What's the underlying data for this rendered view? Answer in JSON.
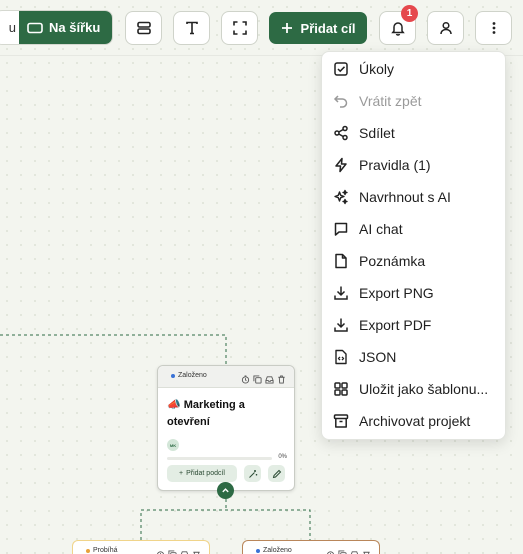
{
  "toolbar": {
    "view_left_label": "u",
    "view_right_label": "Na šířku",
    "add_goal_label": "Přidat cíl",
    "notification_count": "1",
    "accent_color": "#2d6a44",
    "icons": [
      "layout-icon",
      "text-icon",
      "fullscreen-icon",
      "bell-icon",
      "user-icon",
      "more-icon"
    ]
  },
  "menu": {
    "items": [
      {
        "label": "Úkoly",
        "icon": "checkbox-icon",
        "disabled": false
      },
      {
        "label": "Vrátit zpět",
        "icon": "undo-icon",
        "disabled": true
      },
      {
        "label": "Sdílet",
        "icon": "share-icon",
        "disabled": false
      },
      {
        "label": "Pravidla (1)",
        "icon": "lightning-icon",
        "disabled": false
      },
      {
        "label": "Navrhnout s AI",
        "icon": "sparkles-icon",
        "disabled": false
      },
      {
        "label": "AI chat",
        "icon": "chat-icon",
        "disabled": false
      },
      {
        "label": "Poznámka",
        "icon": "note-icon",
        "disabled": false
      },
      {
        "label": "Export PNG",
        "icon": "download-icon",
        "disabled": false
      },
      {
        "label": "Export PDF",
        "icon": "download-icon",
        "disabled": false
      },
      {
        "label": "JSON",
        "icon": "code-file-icon",
        "disabled": false
      },
      {
        "label": "Uložit jako šablonu...",
        "icon": "template-icon",
        "disabled": false
      },
      {
        "label": "Archivovat projekt",
        "icon": "archive-icon",
        "disabled": false
      }
    ]
  },
  "card": {
    "status": "Založeno",
    "emoji": "📣",
    "title": "Marketing a otevření",
    "avatar": "MK",
    "progress": 0,
    "progress_label": "0%",
    "add_subgoal_label": "Přidat podcíl"
  },
  "children": [
    {
      "status": "Probíhá",
      "status_color": "#e8a23a",
      "border_color": "#f0d48a"
    },
    {
      "status": "Založeno",
      "status_color": "#3a72d6",
      "border_color": "#b9865a"
    }
  ]
}
